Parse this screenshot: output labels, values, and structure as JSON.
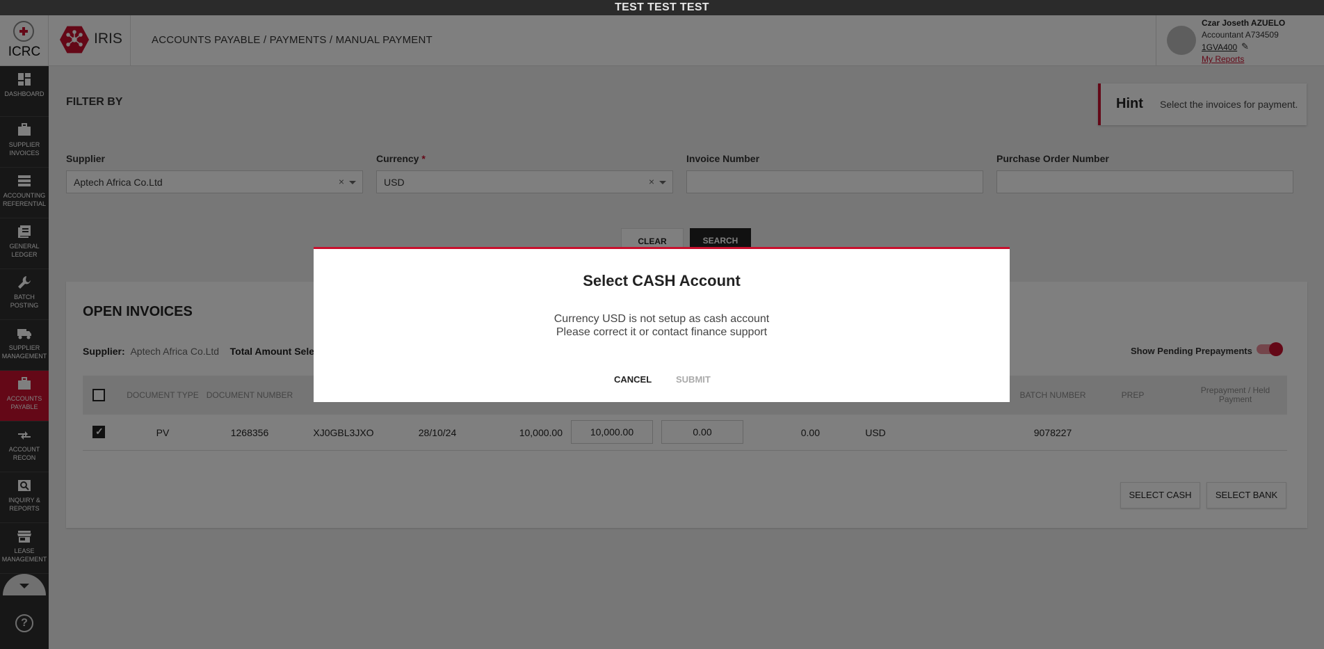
{
  "banner": "TEST TEST TEST",
  "header": {
    "icrc_label": "ICRC",
    "app_name": "IRIS",
    "breadcrumb": "ACCOUNTS PAYABLE / PAYMENTS / MANUAL PAYMENT",
    "user": {
      "name": "Czar Joseth AZUELO",
      "role": "Accountant A734509",
      "code": "1GVA400",
      "reports": "My Reports"
    }
  },
  "sidebar": {
    "items": [
      {
        "line1": "DASHBOARD",
        "line2": "",
        "icon": "dashboard-icon"
      },
      {
        "line1": "SUPPLIER",
        "line2": "INVOICES",
        "icon": "briefcase-icon"
      },
      {
        "line1": "ACCOUNTING",
        "line2": "REFERENTIAL",
        "icon": "list-icon"
      },
      {
        "line1": "GENERAL",
        "line2": "LEDGER",
        "icon": "ledger-icon"
      },
      {
        "line1": "BATCH",
        "line2": "POSTING",
        "icon": "wrench-icon"
      },
      {
        "line1": "SUPPLIER",
        "line2": "MANAGEMENT",
        "icon": "truck-icon"
      },
      {
        "line1": "ACCOUNTS",
        "line2": "PAYABLE",
        "icon": "briefcase-icon"
      },
      {
        "line1": "ACCOUNT",
        "line2": "RECON",
        "icon": "compare-arrows-icon"
      },
      {
        "line1": "INQUIRY &",
        "line2": "REPORTS",
        "icon": "search-report-icon"
      },
      {
        "line1": "LEASE",
        "line2": "MANAGEMENT",
        "icon": "store-icon"
      }
    ],
    "active_index": 6,
    "help": "?"
  },
  "filter": {
    "title": "FILTER BY",
    "hint_title": "Hint",
    "hint_text": "Select the invoices for payment.",
    "supplier_label": "Supplier",
    "supplier_value": "Aptech Africa Co.Ltd",
    "currency_label": "Currency",
    "currency_required": "*",
    "currency_value": "USD",
    "invoice_label": "Invoice Number",
    "invoice_value": "",
    "po_label": "Purchase Order Number",
    "po_value": "",
    "clear_x": "×",
    "clear_button": "CLEAR",
    "search_button": "SEARCH"
  },
  "invoices": {
    "title": "OPEN INVOICES",
    "supplier_label": "Supplier:",
    "supplier_value": "Aptech Africa Co.Ltd",
    "total_label": "Total Amount Selec",
    "pending_label": "Show Pending Prepayments",
    "pending_on": true,
    "columns": {
      "doc_type": "DOCUMENT TYPE",
      "doc_number": "DOCUMENT NUMBER",
      "batch_number": "BATCH NUMBER",
      "prep": "PREP",
      "prepayment_held": "Prepayment / Held Payment"
    },
    "row": {
      "doc_type": "PV",
      "doc_number": "1268356",
      "reference": "XJ0GBL3JXO",
      "date": "28/10/24",
      "amount": "10,000.00",
      "pay_amount": "10,000.00",
      "discount": "0.00",
      "balance": "0.00",
      "currency": "USD",
      "batch": "9078227"
    },
    "select_cash": "SELECT CASH",
    "select_bank": "SELECT BANK"
  },
  "modal": {
    "title": "Select CASH Account",
    "line1": "Currency USD is not setup as cash account",
    "line2": "Please correct it or contact finance support",
    "cancel": "CANCEL",
    "submit": "SUBMIT"
  }
}
